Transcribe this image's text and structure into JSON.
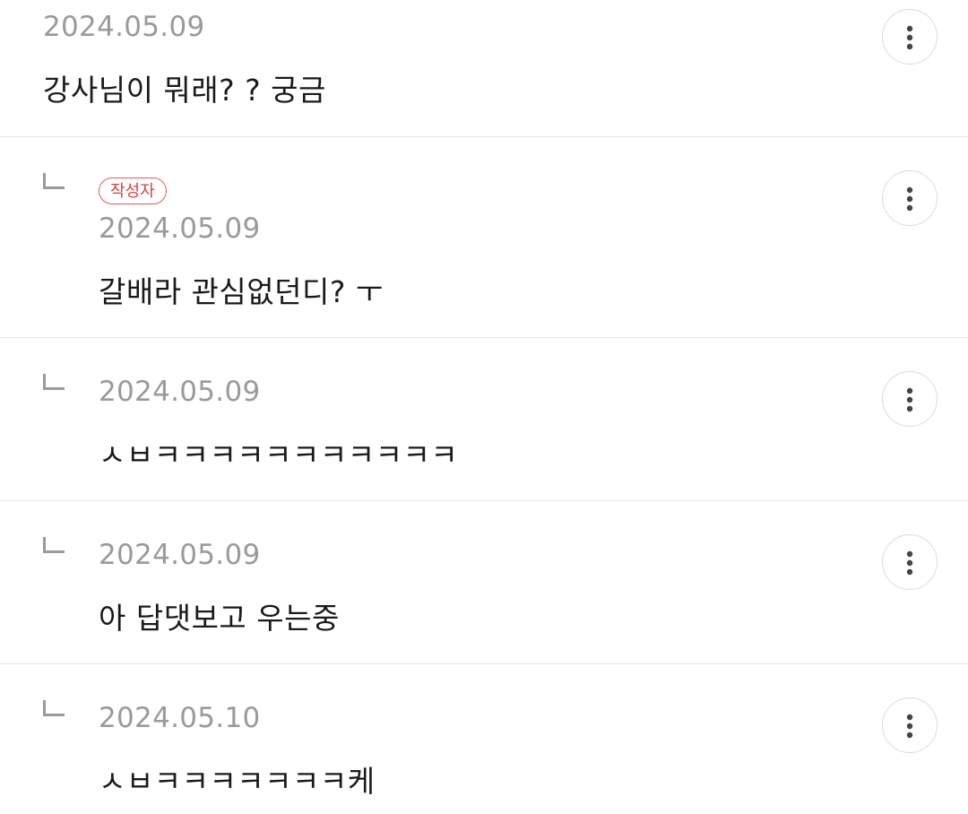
{
  "comments": [
    {
      "date": "2024.05.09",
      "text": "강사님이 뭐래? ?  궁금",
      "is_reply": false,
      "more_icon": "more-vertical-icon"
    },
    {
      "date": "2024.05.09",
      "text": "갈배라 관심없던디?  ㅜ",
      "is_reply": true,
      "badge": "작성자",
      "reply_icon": "reply-arrow-icon",
      "more_icon": "more-vertical-icon"
    },
    {
      "date": "2024.05.09",
      "text": "ㅅㅂㅋㅋㅋㅋㅋㅋㅋㅋㅋㅋㅋ",
      "is_reply": true,
      "reply_icon": "reply-arrow-icon",
      "more_icon": "more-vertical-icon"
    },
    {
      "date": "2024.05.09",
      "text": "아 답댓보고 우는중",
      "is_reply": true,
      "reply_icon": "reply-arrow-icon",
      "more_icon": "more-vertical-icon"
    },
    {
      "date": "2024.05.10",
      "text": "ㅅㅂㅋㅋㅋㅋㅋㅋㅋ케",
      "is_reply": true,
      "reply_icon": "reply-arrow-icon",
      "more_icon": "more-vertical-icon"
    }
  ],
  "colors": {
    "date": "#9a9a9a",
    "text": "#1a1a1a",
    "badge": "#d94040",
    "divider": "#e4e4e4"
  }
}
